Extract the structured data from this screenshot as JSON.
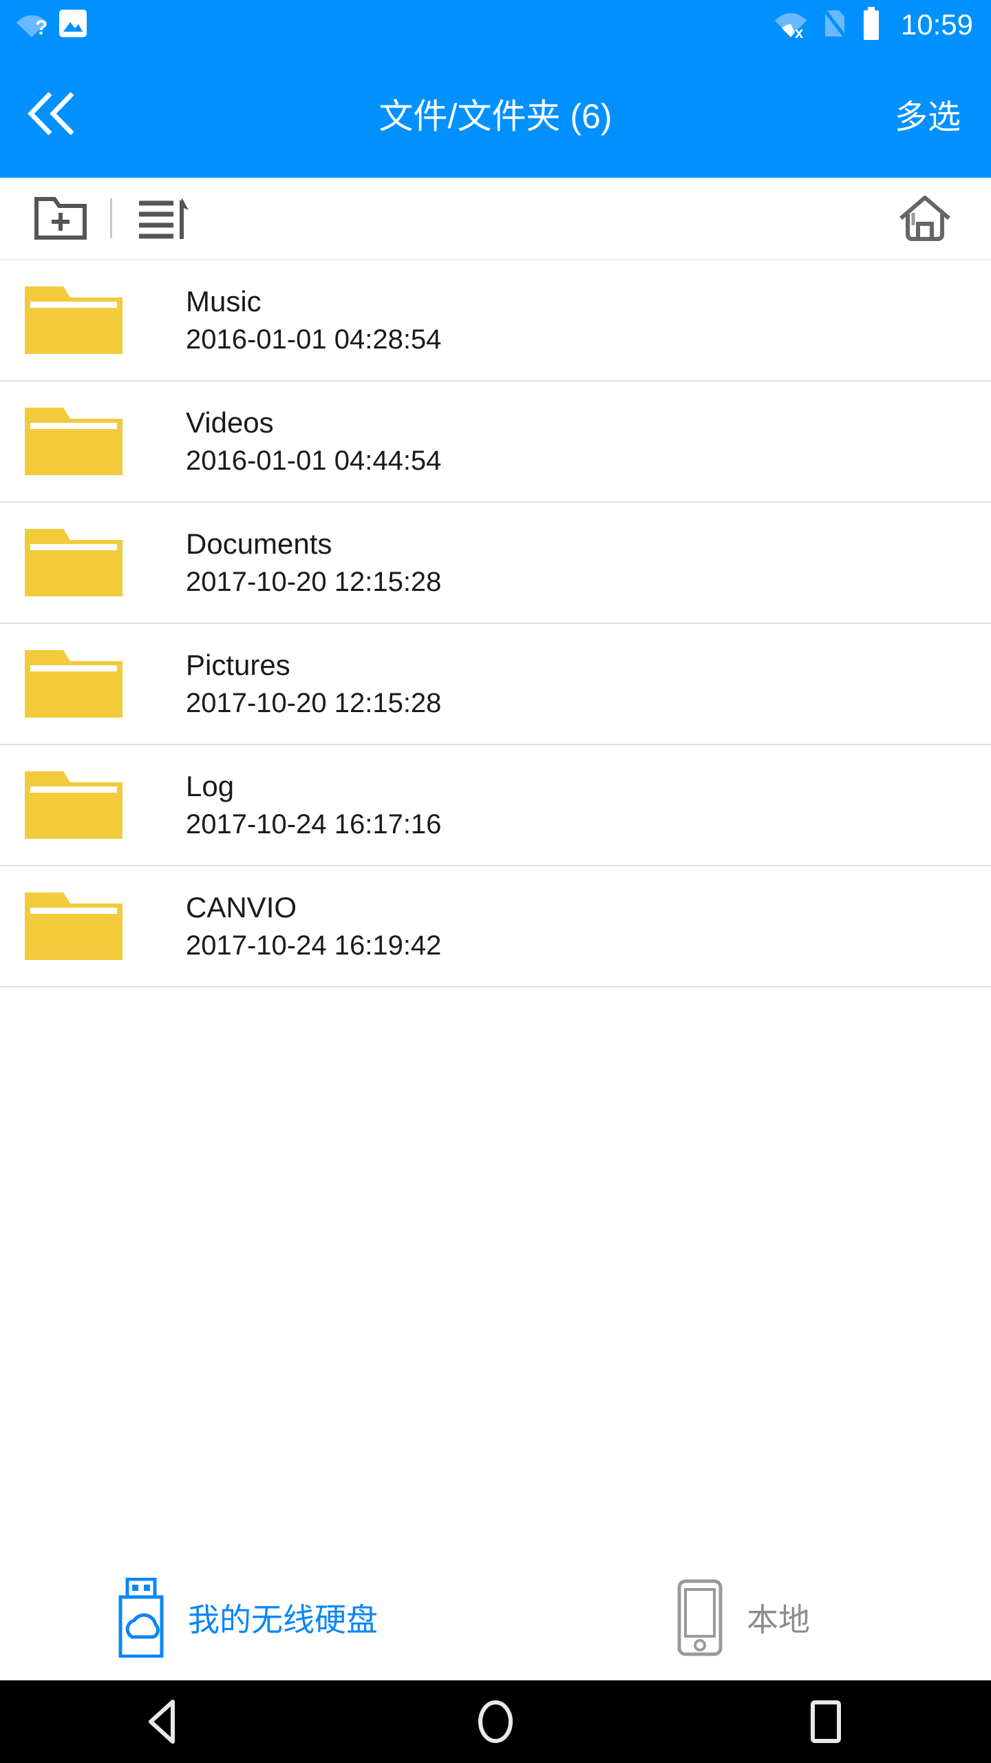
{
  "colors": {
    "primary_blue": "#0091ff",
    "tab_active_blue": "#0b86f8",
    "folder_yellow": "#f2cb3c",
    "icon_gray": "#555555",
    "tab_inactive_gray": "#8c8c8c",
    "divider_gray": "#e0e0e0",
    "nav_bar_black": "#000000"
  },
  "status_bar": {
    "left_icons": [
      {
        "name": "wifi-question-icon",
        "glyph": "wifi-?"
      },
      {
        "name": "image-notification-icon",
        "glyph": "picture"
      }
    ],
    "right_icons": [
      {
        "name": "wifi-no-internet-icon",
        "glyph": "wifi-x"
      },
      {
        "name": "sim-card-off-icon",
        "glyph": "sim-slash"
      },
      {
        "name": "battery-full-icon",
        "glyph": "battery"
      }
    ],
    "clock": "10:59"
  },
  "app_bar": {
    "back_label": "«",
    "title": "文件/文件夹 (6)",
    "action_label": "多选"
  },
  "toolbar": {
    "new_folder_label": "new-folder",
    "sort_label": "sort",
    "home_label": "home"
  },
  "file_list": {
    "count": 6,
    "items": [
      {
        "name": "Music",
        "date": "2016-01-01 04:28:54",
        "type": "folder"
      },
      {
        "name": "Videos",
        "date": "2016-01-01 04:44:54",
        "type": "folder"
      },
      {
        "name": "Documents",
        "date": "2017-10-20 12:15:28",
        "type": "folder"
      },
      {
        "name": "Pictures",
        "date": "2017-10-20 12:15:28",
        "type": "folder"
      },
      {
        "name": "Log",
        "date": "2017-10-24 16:17:16",
        "type": "folder"
      },
      {
        "name": "CANVIO",
        "date": "2017-10-24 16:19:42",
        "type": "folder"
      }
    ]
  },
  "tab_bar": {
    "tabs": [
      {
        "label": "我的无线硬盘",
        "icon": "usb-cloud-drive-icon",
        "active": true
      },
      {
        "label": "本地",
        "icon": "phone-icon",
        "active": false
      }
    ]
  },
  "nav_bar": {
    "back": "back",
    "home": "home",
    "recents": "recents"
  }
}
